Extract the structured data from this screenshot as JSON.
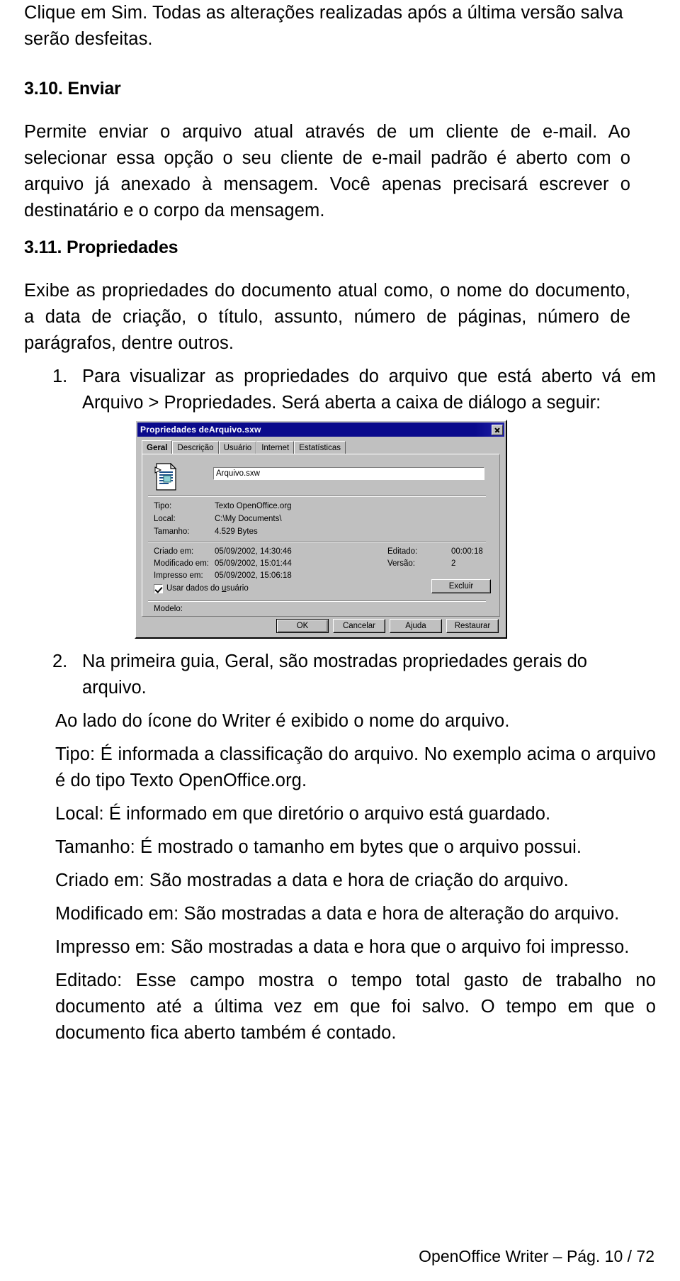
{
  "document": {
    "intro_paragraph": "Clique em Sim. Todas as alterações realizadas após a última versão salva serão desfeitas.",
    "section_310": {
      "heading": "3.10. Enviar",
      "paragraph": "Permite enviar o arquivo atual através de um cliente de e-mail. Ao selecionar essa opção o seu cliente de e-mail padrão é aberto com o arquivo já anexado à mensagem. Você apenas precisará escrever o destinatário e o corpo da mensagem."
    },
    "section_311": {
      "heading": "3.11. Propriedades",
      "paragraph": "Exibe as propriedades do documento atual como, o nome do documento, a data de criação, o título, assunto, número de páginas, número de parágrafos, dentre outros.",
      "steps": [
        {
          "number": "1.",
          "text": "Para visualizar as propriedades do arquivo que está aberto vá em Arquivo > Propriedades. Será aberta a caixa de diálogo a seguir:"
        },
        {
          "number": "2.",
          "text": "Na primeira guia, Geral, são mostradas propriedades gerais do arquivo."
        }
      ],
      "descriptions": [
        "Ao lado do ícone do Writer é exibido o nome do arquivo.",
        "Tipo: É informada a classificação do arquivo. No exemplo acima o arquivo é do tipo Texto OpenOffice.org.",
        "Local: É informado em que diretório o arquivo está guardado.",
        "Tamanho: É mostrado o tamanho em bytes que o arquivo possui.",
        "Criado em: São mostradas a data e hora de criação do arquivo.",
        "Modificado em: São mostradas a data e hora de alteração do arquivo.",
        "Impresso em: São mostradas a data e hora que o arquivo foi impresso.",
        "Editado: Esse campo mostra o tempo total gasto de trabalho no documento até a última vez em que foi salvo. O tempo em que o documento fica aberto também é contado."
      ]
    }
  },
  "dialog": {
    "title": "Propriedades deArquivo.sxw",
    "close_icon": "close-icon",
    "document_icon": "writer-document-icon",
    "tabs": [
      {
        "label": "Geral",
        "active": true
      },
      {
        "label": "Descrição",
        "active": false
      },
      {
        "label": "Usuário",
        "active": false
      },
      {
        "label": "Internet",
        "active": false
      },
      {
        "label": "Estatísticas",
        "active": false
      }
    ],
    "file_name": "Arquivo.sxw",
    "fields": [
      {
        "label": "Tipo:",
        "value": "Texto OpenOffice.org"
      },
      {
        "label": "Local:",
        "value": "C:\\My Documents\\"
      },
      {
        "label": "Tamanho:",
        "value": "4.529 Bytes"
      }
    ],
    "dates": [
      {
        "label": "Criado em:",
        "value": "05/09/2002, 14:30:46"
      },
      {
        "label": "Modificado em:",
        "value": "05/09/2002, 15:01:44"
      },
      {
        "label": "Impresso em:",
        "value": "05/09/2002, 15:06:18"
      }
    ],
    "right_fields": [
      {
        "label": "Editado:",
        "value": "00:00:18"
      },
      {
        "label": "Versão:",
        "value": "2"
      }
    ],
    "checkbox": {
      "label_a": "Usar dados do ",
      "label_u": "u",
      "label_b": "suário",
      "checked": true
    },
    "delete_button": "Excluir",
    "modelo_label": "Modelo:",
    "buttons": [
      {
        "label": "OK",
        "default": true
      },
      {
        "label": "Cancelar",
        "default": false
      },
      {
        "label": "Ajuda",
        "default": false,
        "underline_index": 1
      },
      {
        "label": "Restaurar",
        "default": false,
        "underline_index": 0
      }
    ]
  },
  "footer": {
    "text": "OpenOffice Writer – Pág. 10 / 72"
  },
  "colors": {
    "titlebar": "#0a0a8c",
    "dialog_face": "#c0c0c0",
    "text": "#000000",
    "page_background": "#ffffff"
  }
}
